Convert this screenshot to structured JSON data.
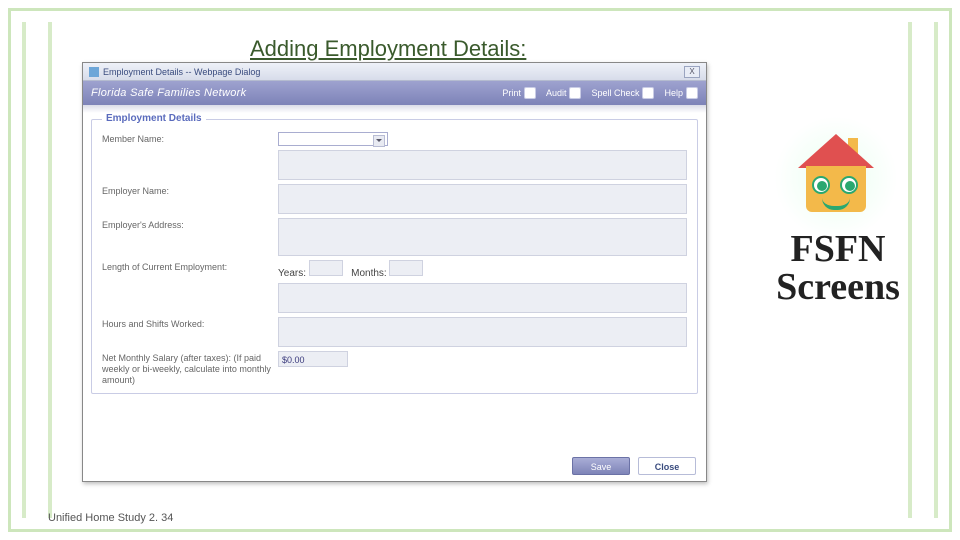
{
  "slide": {
    "title": "Adding Employment Details:",
    "footer": "Unified Home Study 2. 34",
    "side_label": "FSFN Screens"
  },
  "dialog": {
    "window_title": "Employment Details -- Webpage Dialog",
    "close_x": "X",
    "banner_title": "Florida Safe Families Network",
    "actions": {
      "print": "Print",
      "audit": "Audit",
      "spellcheck": "Spell Check",
      "help": "Help"
    },
    "groupbox_title": "Employment Details",
    "fields": {
      "member_name": "Member Name:",
      "employer_name": "Employer Name:",
      "employer_address": "Employer's Address:",
      "length_employment": "Length of Current Employment:",
      "years_label": "Years:",
      "months_label": "Months:",
      "hours_shifts": "Hours and Shifts Worked:",
      "net_salary": "Net Monthly Salary (after taxes): (If paid weekly or bi-weekly, calculate into monthly amount)",
      "salary_value": "$0.00"
    },
    "buttons": {
      "save": "Save",
      "close": "Close"
    }
  }
}
